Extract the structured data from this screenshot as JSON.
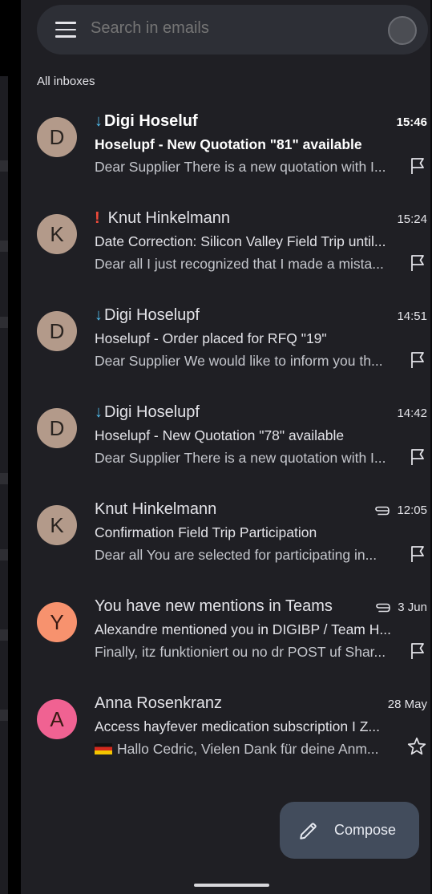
{
  "search": {
    "placeholder": "Search in emails"
  },
  "section_label": "All inboxes",
  "colors": {
    "background": "#1f1f24",
    "search_bg": "#2d2f36",
    "accent_priority": "#4fb8e8",
    "important": "#f04a3a",
    "compose_bg": "#424c5c"
  },
  "mails": [
    {
      "initial": "D",
      "avatar_color": "#b39a8a",
      "sender": "Digi Hoseluf",
      "priority": "low",
      "unread": true,
      "time": "15:46",
      "subject": "Hoselupf - New Quotation \"81\" available",
      "snippet": "Dear Supplier There is a new quotation with I...",
      "action": "flag-icon"
    },
    {
      "initial": "K",
      "avatar_color": "#b39a8a",
      "sender": "Knut Hinkelmann",
      "priority": "high",
      "unread": false,
      "time": "15:24",
      "subject": "Date Correction: Silicon Valley Field Trip until...",
      "snippet": "Dear all I just recognized that I made a mista...",
      "action": "flag-icon"
    },
    {
      "initial": "D",
      "avatar_color": "#b39a8a",
      "sender": "Digi Hoselupf",
      "priority": "low",
      "unread": false,
      "time": "14:51",
      "subject": "Hoselupf - Order placed for RFQ \"19\"",
      "snippet": "Dear Supplier We would like to inform you th...",
      "action": "flag-icon"
    },
    {
      "initial": "D",
      "avatar_color": "#b39a8a",
      "sender": "Digi Hoselupf",
      "priority": "low",
      "unread": false,
      "time": "14:42",
      "subject": "Hoselupf - New Quotation \"78\" available",
      "snippet": "Dear Supplier There is a new quotation with I...",
      "action": "flag-icon"
    },
    {
      "initial": "K",
      "avatar_color": "#b39a8a",
      "sender": "Knut Hinkelmann",
      "priority": "none",
      "unread": false,
      "time": "12:05",
      "attachment": true,
      "subject": "Confirmation Field Trip Participation",
      "snippet": "Dear all You are selected for participating in...",
      "action": "flag-icon"
    },
    {
      "initial": "Y",
      "avatar_color": "#f7926e",
      "sender": "You have new mentions in Teams",
      "priority": "none",
      "unread": false,
      "time": "3 Jun",
      "attachment": true,
      "subject": "Alexandre mentioned you in DIGIBP / Team H...",
      "snippet": "Finally, itz funktioniert ou no dr POST uf Shar...",
      "action": "flag-icon"
    },
    {
      "initial": "A",
      "avatar_color": "#f06292",
      "sender": "Anna Rosenkranz",
      "priority": "none",
      "unread": false,
      "time": "28 May",
      "subject": "Access hayfever medication subscription I Z...",
      "snippet": "Hallo Cedric, Vielen Dank für deine Anm...",
      "snippet_flag": "de-flag",
      "action": "star-icon"
    }
  ],
  "compose": {
    "label": "Compose"
  }
}
